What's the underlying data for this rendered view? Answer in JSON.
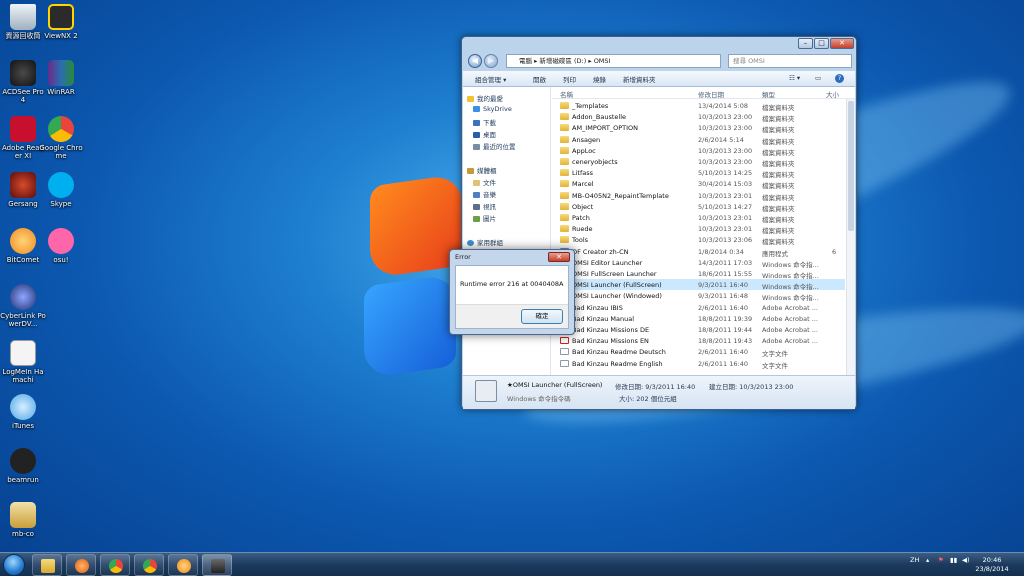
{
  "desktop": {
    "icons": [
      {
        "label": "資源回收筒",
        "icon": "recycle-bin-icon",
        "color": "#cfd8e0"
      },
      {
        "label": "ViewNX 2",
        "icon": "viewnx-icon",
        "color": "#2b2b2b"
      },
      {
        "label": "ACDSee Pro 4",
        "icon": "acdsee-icon",
        "color": "#1a1a1a"
      },
      {
        "label": "WinRAR",
        "icon": "winrar-icon",
        "color": "#6a2b8a"
      },
      {
        "label": "Adobe Reader XI",
        "icon": "adobe-reader-icon",
        "color": "#c8102e"
      },
      {
        "label": "Google Chrome",
        "icon": "chrome-icon",
        "color": "#e8453c"
      },
      {
        "label": "Gersang",
        "icon": "gersang-icon",
        "color": "#8a1a1a"
      },
      {
        "label": "Skype",
        "icon": "skype-icon",
        "color": "#00aff0"
      },
      {
        "label": "BitComet",
        "icon": "bitcomet-icon",
        "color": "#f08a1c"
      },
      {
        "label": "osu!",
        "icon": "osu-icon",
        "color": "#ff66aa"
      },
      {
        "label": "CyberLink PowerDV...",
        "icon": "powerdvd-icon",
        "color": "#1d2f6f"
      },
      {
        "label": "LogMeIn Hamachi",
        "icon": "hamachi-icon",
        "color": "#f4f4f4"
      },
      {
        "label": "iTunes",
        "icon": "itunes-icon",
        "color": "#4aa6e8"
      },
      {
        "label": "beamrun",
        "icon": "beamrun-icon",
        "color": "#222222"
      },
      {
        "label": "mb-co",
        "icon": "mbco-icon",
        "color": "#e5c77a"
      }
    ]
  },
  "explorer": {
    "breadcrumb": [
      "電腦",
      "新增磁碟區 (D:)",
      "OMSI"
    ],
    "search_placeholder": "搜尋 OMSI",
    "toolbar": {
      "organize": "組合管理 ▾",
      "open": "開啟",
      "print": "列印",
      "burn": "燒錄",
      "new_folder": "新增資料夾"
    },
    "nav": {
      "favorites": "我的最愛",
      "skydrive": "SkyDrive",
      "downloads": "下載",
      "desktop": "桌面",
      "recent": "最近的位置",
      "libraries": "媒體櫃",
      "documents": "文件",
      "music": "音樂",
      "videos": "視訊",
      "pictures": "圖片",
      "homegroup": "家用群組"
    },
    "columns": {
      "name": "名稱",
      "date": "修改日期",
      "type": "類型",
      "size": "大小"
    },
    "files": [
      {
        "name": "_Templates",
        "date": "13/4/2014 5:08",
        "type": "檔案資料夾",
        "size": "",
        "kind": "folder"
      },
      {
        "name": "Addon_Baustelle",
        "date": "10/3/2013 23:00",
        "type": "檔案資料夾",
        "size": "",
        "kind": "folder"
      },
      {
        "name": "AM_IMPORT_OPTION",
        "date": "10/3/2013 23:00",
        "type": "檔案資料夾",
        "size": "",
        "kind": "folder"
      },
      {
        "name": "Ansagen",
        "date": "2/6/2014 5:14",
        "type": "檔案資料夾",
        "size": "",
        "kind": "folder"
      },
      {
        "name": "AppLoc",
        "date": "10/3/2013 23:00",
        "type": "檔案資料夾",
        "size": "",
        "kind": "folder"
      },
      {
        "name": "ceneryobjects",
        "date": "10/3/2013 23:00",
        "type": "檔案資料夾",
        "size": "",
        "kind": "folder"
      },
      {
        "name": "Litfass",
        "date": "5/10/2013 14:25",
        "type": "檔案資料夾",
        "size": "",
        "kind": "folder"
      },
      {
        "name": "Marcel",
        "date": "30/4/2014 15:03",
        "type": "檔案資料夾",
        "size": "",
        "kind": "folder"
      },
      {
        "name": "MB-O405N2_RepaintTemplate",
        "date": "10/3/2013 23:01",
        "type": "檔案資料夾",
        "size": "",
        "kind": "folder"
      },
      {
        "name": "Object",
        "date": "5/10/2013 14:27",
        "type": "檔案資料夾",
        "size": "",
        "kind": "folder"
      },
      {
        "name": "Patch",
        "date": "10/3/2013 23:01",
        "type": "檔案資料夾",
        "size": "",
        "kind": "folder"
      },
      {
        "name": "Ruede",
        "date": "10/3/2013 23:01",
        "type": "檔案資料夾",
        "size": "",
        "kind": "folder"
      },
      {
        "name": "Tools",
        "date": "10/3/2013 23:06",
        "type": "檔案資料夾",
        "size": "",
        "kind": "folder"
      },
      {
        "name": "OF Creator zh-CN",
        "date": "1/8/2014 0:34",
        "type": "應用程式",
        "size": "6",
        "kind": "exe"
      },
      {
        "name": "OMSI Editor Launcher",
        "date": "14/3/2011 17:03",
        "type": "Windows 命令指...",
        "size": "",
        "kind": "exe"
      },
      {
        "name": "OMSI FullScreen Launcher",
        "date": "18/6/2011 15:55",
        "type": "Windows 命令指...",
        "size": "",
        "kind": "exe"
      },
      {
        "name": "OMSI Launcher (FullScreen)",
        "date": "9/3/2011 16:40",
        "type": "Windows 命令指...",
        "size": "",
        "kind": "exe"
      },
      {
        "name": "OMSI Launcher (Windowed)",
        "date": "9/3/2011 16:48",
        "type": "Windows 命令指...",
        "size": "",
        "kind": "exe"
      },
      {
        "name": "Bad Kinzau IBIS",
        "date": "2/6/2011 16:40",
        "type": "Adobe Acrobat ...",
        "size": "",
        "kind": "pdf"
      },
      {
        "name": "Bad Kinzau Manual",
        "date": "18/8/2011 19:39",
        "type": "Adobe Acrobat ...",
        "size": "",
        "kind": "pdf"
      },
      {
        "name": "Bad Kinzau Missions DE",
        "date": "18/8/2011 19:44",
        "type": "Adobe Acrobat ...",
        "size": "",
        "kind": "pdf"
      },
      {
        "name": "Bad Kinzau Missions EN",
        "date": "18/8/2011 19:43",
        "type": "Adobe Acrobat ...",
        "size": "",
        "kind": "pdf"
      },
      {
        "name": "Bad Kinzau Readme Deutsch",
        "date": "2/6/2011 16:40",
        "type": "文字文件",
        "size": "",
        "kind": "txt"
      },
      {
        "name": "Bad Kinzau Readme English",
        "date": "2/6/2011 16:40",
        "type": "文字文件",
        "size": "",
        "kind": "txt"
      }
    ],
    "details": {
      "name": "★OMSI Launcher (FullScreen)",
      "kind": "Windows 命令指令碼",
      "modified": "修改日期: 9/3/2011 16:40",
      "created": "建立日期: 10/3/2013 23:00",
      "size": "大小: 202 個位元組"
    }
  },
  "dialog": {
    "title": "Error",
    "close": "✕",
    "message": "Runtime error 216 at 0040408A",
    "ok": "確定"
  },
  "taskbar": {
    "ime": "ZH",
    "time": "20:46",
    "date": "23/8/2014"
  }
}
